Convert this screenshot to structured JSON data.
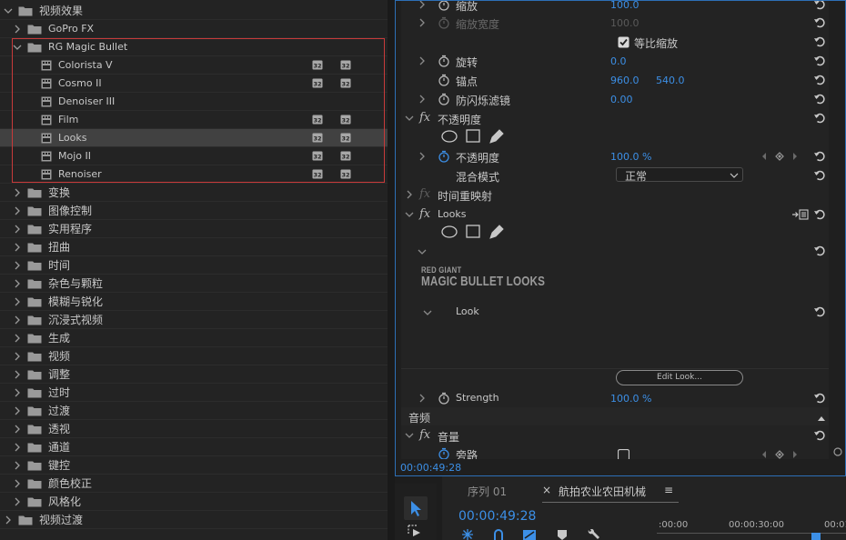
{
  "effects_panel": {
    "rows": [
      {
        "label": "视频效果",
        "depth": 0,
        "open": true,
        "kind": "folder"
      },
      {
        "label": "GoPro FX",
        "depth": 1,
        "open": false,
        "kind": "folder"
      },
      {
        "label": "RG Magic Bullet",
        "depth": 1,
        "open": true,
        "kind": "folder"
      },
      {
        "label": "Colorista V",
        "depth": 2,
        "kind": "effect",
        "accel32": true,
        "accelyuv": true
      },
      {
        "label": "Cosmo II",
        "depth": 2,
        "kind": "effect",
        "accel32": true,
        "accelyuv": true
      },
      {
        "label": "Denoiser III",
        "depth": 2,
        "kind": "effect",
        "accel32": false,
        "accelyuv": false
      },
      {
        "label": "Film",
        "depth": 2,
        "kind": "effect",
        "accel32": true,
        "accelyuv": true
      },
      {
        "label": "Looks",
        "depth": 2,
        "kind": "effect",
        "accel32": true,
        "accelyuv": true,
        "selected": true
      },
      {
        "label": "Mojo II",
        "depth": 2,
        "kind": "effect",
        "accel32": true,
        "accelyuv": true
      },
      {
        "label": "Renoiser",
        "depth": 2,
        "kind": "effect",
        "accel32": true,
        "accelyuv": true
      },
      {
        "label": "变换",
        "depth": 1,
        "open": false,
        "kind": "folder"
      },
      {
        "label": "图像控制",
        "depth": 1,
        "open": false,
        "kind": "folder"
      },
      {
        "label": "实用程序",
        "depth": 1,
        "open": false,
        "kind": "folder"
      },
      {
        "label": "扭曲",
        "depth": 1,
        "open": false,
        "kind": "folder"
      },
      {
        "label": "时间",
        "depth": 1,
        "open": false,
        "kind": "folder"
      },
      {
        "label": "杂色与颗粒",
        "depth": 1,
        "open": false,
        "kind": "folder"
      },
      {
        "label": "模糊与锐化",
        "depth": 1,
        "open": false,
        "kind": "folder"
      },
      {
        "label": "沉浸式视频",
        "depth": 1,
        "open": false,
        "kind": "folder"
      },
      {
        "label": "生成",
        "depth": 1,
        "open": false,
        "kind": "folder"
      },
      {
        "label": "视频",
        "depth": 1,
        "open": false,
        "kind": "folder"
      },
      {
        "label": "调整",
        "depth": 1,
        "open": false,
        "kind": "folder"
      },
      {
        "label": "过时",
        "depth": 1,
        "open": false,
        "kind": "folder"
      },
      {
        "label": "过渡",
        "depth": 1,
        "open": false,
        "kind": "folder"
      },
      {
        "label": "透视",
        "depth": 1,
        "open": false,
        "kind": "folder"
      },
      {
        "label": "通道",
        "depth": 1,
        "open": false,
        "kind": "folder"
      },
      {
        "label": "键控",
        "depth": 1,
        "open": false,
        "kind": "folder"
      },
      {
        "label": "颜色校正",
        "depth": 1,
        "open": false,
        "kind": "folder"
      },
      {
        "label": "风格化",
        "depth": 1,
        "open": false,
        "kind": "folder"
      },
      {
        "label": "视频过渡",
        "depth": 0,
        "open": false,
        "kind": "folder"
      }
    ]
  },
  "effect_controls": {
    "scale": {
      "label": "缩放",
      "value": "100.0"
    },
    "scale_width": {
      "label": "缩放宽度",
      "value": "100.0"
    },
    "uniform_scale": {
      "label": "等比缩放",
      "checked": true
    },
    "rotation": {
      "label": "旋转",
      "value": "0.0"
    },
    "anchor": {
      "label": "锚点",
      "x": "960.0",
      "y": "540.0"
    },
    "antiflicker": {
      "label": "防闪烁滤镜",
      "value": "0.00"
    },
    "opacity_group": {
      "label": "不透明度"
    },
    "opacity": {
      "label": "不透明度",
      "value": "100.0 %"
    },
    "blend_mode": {
      "label": "混合模式",
      "value": "正常"
    },
    "time_remap": {
      "label": "时间重映射"
    },
    "looks_group": {
      "label": "Looks"
    },
    "logo": {
      "line1": "RED GIANT",
      "line2": "MAGIC BULLET LOOKS"
    },
    "look": {
      "label": "Look"
    },
    "edit_look": {
      "label": "Edit Look..."
    },
    "strength": {
      "label": "Strength",
      "value": "100.0 %"
    },
    "audio_section": {
      "label": "音频"
    },
    "volume_group": {
      "label": "音量"
    },
    "bypass": {
      "label": "旁路"
    },
    "timecode": "00:00:49:28"
  },
  "timeline": {
    "tabs": [
      {
        "label": "序列 01"
      },
      {
        "label": "航拍农业农田机械"
      }
    ],
    "close_symbol": "×",
    "menu_symbol": "≡",
    "timecode": "00:00:49:28",
    "ruler": [
      ":00:00",
      "00:00:30:00",
      "00:01"
    ]
  },
  "colors": {
    "accent_blue": "#3c8fe6",
    "selection_box_red": "#c83a3a",
    "panel_border_blue": "#2d6fb6"
  }
}
